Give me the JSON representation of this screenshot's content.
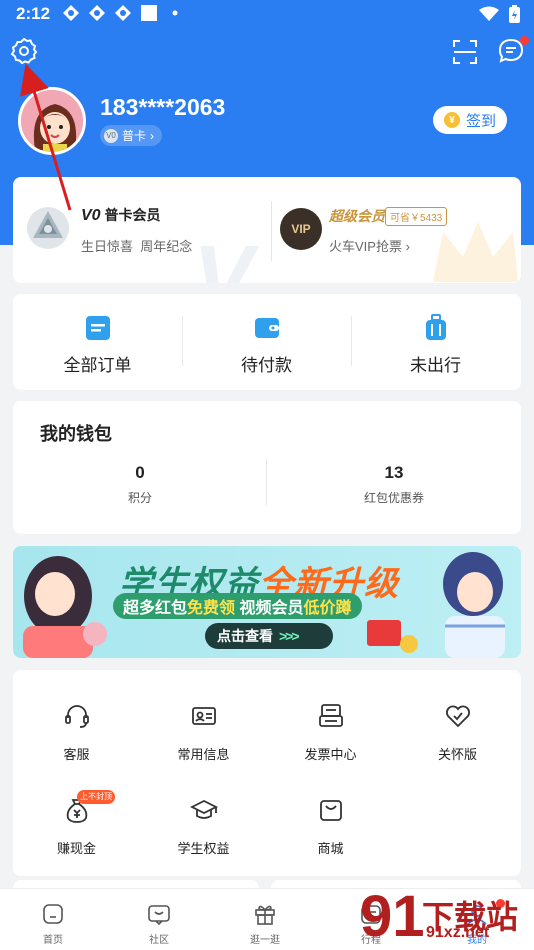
{
  "status_bar": {
    "time": "2:12"
  },
  "profile": {
    "phone": "183****2063",
    "level_badge": "V0",
    "level_label": "普卡",
    "signin_label": "签到",
    "signin_coin": "¥"
  },
  "membership": {
    "level_mark": "V0",
    "title": "普卡会员",
    "benefits": "生日惊喜  周年纪念",
    "super_title": "超级会员",
    "super_save": "可省￥5433",
    "super_sub": "火车VIP抢票",
    "vip_badge": "VIP"
  },
  "orders": [
    {
      "label": "全部订单"
    },
    {
      "label": "待付款"
    },
    {
      "label": "未出行"
    }
  ],
  "wallet": {
    "title": "我的钱包",
    "items": [
      {
        "value": "0",
        "label": "积分"
      },
      {
        "value": "13",
        "label": "红包优惠券"
      }
    ]
  },
  "banner": {
    "headline_a": "学生权益",
    "headline_b": "全新升级",
    "sub_a": "超多红包",
    "sub_b": "免费领",
    "sub_c": "视频会员",
    "sub_d": "低价蹲",
    "cta": "点击查看",
    "cta_arrows": ">>>"
  },
  "services": [
    {
      "label": "客服",
      "icon": "headset-icon"
    },
    {
      "label": "常用信息",
      "icon": "id-card-icon"
    },
    {
      "label": "发票中心",
      "icon": "invoice-icon"
    },
    {
      "label": "关怀版",
      "icon": "heart-check-icon"
    },
    {
      "label": "赚现金",
      "icon": "money-bag-icon",
      "tag": "上不封顶"
    },
    {
      "label": "学生权益",
      "icon": "graduation-cap-icon"
    },
    {
      "label": "商城",
      "icon": "shopping-bag-icon"
    }
  ],
  "tabs": [
    {
      "label": "首页"
    },
    {
      "label": "社区"
    },
    {
      "label": "逛一逛"
    },
    {
      "label": "行程"
    },
    {
      "label": "我的"
    }
  ],
  "watermark": {
    "big": "下载站",
    "small": "91xz.net",
    "digits": "91"
  },
  "colors": {
    "primary": "#2b7df2",
    "accent_red": "#ff3b30",
    "gold": "#c8963e"
  }
}
